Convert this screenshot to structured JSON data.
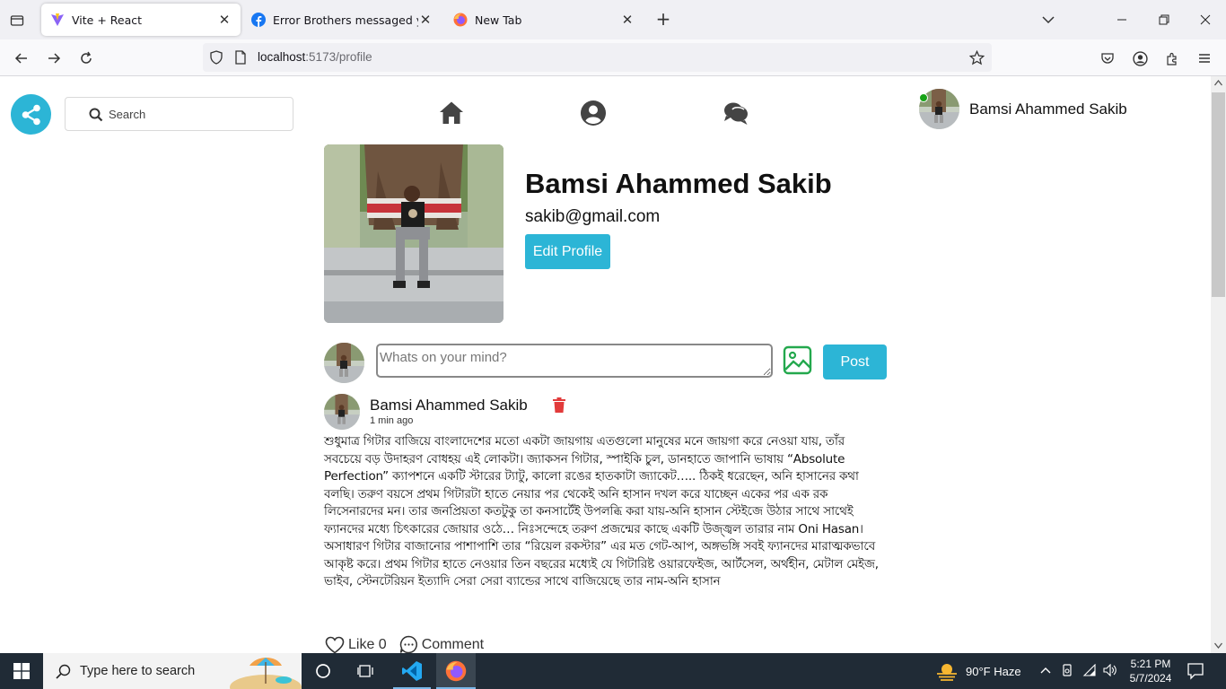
{
  "browser": {
    "tabs": [
      {
        "title": "Vite + React",
        "active": true
      },
      {
        "title": "Error Brothers messaged you",
        "active": false
      },
      {
        "title": "New Tab",
        "active": false
      }
    ],
    "url_host": "localhost",
    "url_rest": ":5173/profile"
  },
  "app": {
    "search_placeholder": "Search",
    "accent_color": "#2cb5d6",
    "current_user": "Bamsi Ahammed Sakib"
  },
  "profile": {
    "name": "Bamsi Ahammed Sakib",
    "email": "sakib@gmail.com",
    "edit_label": "Edit Profile"
  },
  "composer": {
    "placeholder": "Whats on your mind?",
    "post_label": "Post"
  },
  "post": {
    "author": "Bamsi Ahammed Sakib",
    "time": "1 min ago",
    "body": "শুধুমাত্র গিটার বাজিয়ে বাংলাদেশের মতো একটা জায়গায় এতগুলো মানুষের মনে জায়গা করে নেওয়া যায়, তাঁর সবচেয়ে বড় উদাহরণ বোধহয় এই লোকটা। জ্যাকসন গিটার, স্পাইকি চুল, ডানহাতে জাপানি ভাষায় “Absolute Perfection” ক্যাপশনে একটি স্টারের ট্যাটু, কালো রঙের হাতকাটা জ্যাকেট….. ঠিকই ধরেছেন, অনি হাসানের কথা বলছি। তরুণ বয়সে প্রথম গিটারটা হাতে নেয়ার পর থেকেই অনি হাসান দখল করে যাচ্ছেন একের পর এক রক লিসেনারদের মন। তার জনপ্রিয়তা কতটুকু তা কনসার্টেই উপলব্ধি করা যায়-অনি হাসান স্টেইজে উঠার সাথে সাথেই ফ্যানদের মধ্যে চিৎকারের জোয়ার ওঠে… নিঃসন্দেহে তরুণ প্রজন্মের কাছে একটি উজ্জ্বল তারার নাম Oni Hasan। অসাধারণ গিটার বাজানোর পাশাপাশি তার “রিয়েল রকস্টার” এর মত গেট-আপ, অঙ্গভঙ্গি সবই ফ্যানদের মারাত্মকভাবে আকৃষ্ট করে। প্রথম গিটার হাতে নেওয়ার তিন বছরের মধ্যেই যে গিটারিষ্ট ওয়ারফেইজ, আর্টসেল, অর্থহীন, মেটাল মেইজ, ভাইব, স্টেনটেরিয়ন ইত্যাদি সেরা সেরা ব্যান্ডের সাথে বাজিয়েছে তার নাম-অনি হাসান",
    "like_label": "Like 0",
    "comment_label": "Comment"
  },
  "taskbar": {
    "search_placeholder": "Type here to search",
    "weather": "90°F  Haze",
    "time": "5:21 PM",
    "date": "5/7/2024"
  }
}
